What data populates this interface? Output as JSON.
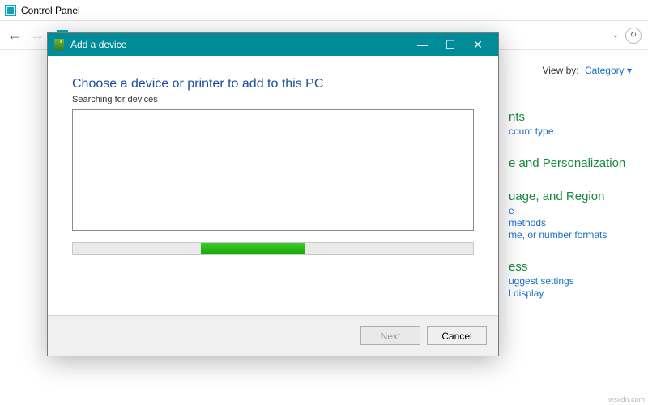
{
  "cp": {
    "title": "Control Panel",
    "breadcrumb": "Control Panel",
    "viewby_label": "View by:",
    "viewby_value": "Category",
    "categories": [
      {
        "heading": "nts",
        "links": [
          "count type"
        ]
      },
      {
        "heading": "e and Personalization",
        "links": []
      },
      {
        "heading": "uage, and Region",
        "links": [
          "e",
          "methods",
          "me, or number formats"
        ]
      },
      {
        "heading": "ess",
        "links": [
          "uggest settings",
          "l display"
        ]
      }
    ]
  },
  "dialog": {
    "title": "Add a device",
    "heading": "Choose a device or printer to add to this PC",
    "subtext": "Searching for devices",
    "next_label": "Next",
    "cancel_label": "Cancel"
  },
  "watermark": "wsxdn.com"
}
